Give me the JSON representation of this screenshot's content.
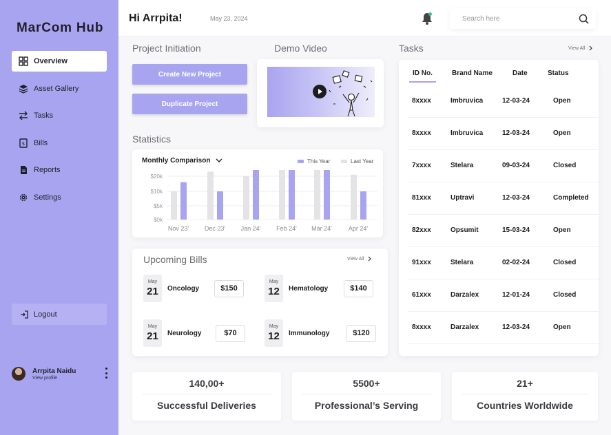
{
  "app": {
    "brand": "MarCom Hub"
  },
  "sidebar": {
    "items": [
      {
        "label": "Overview",
        "icon": "grid-icon",
        "active": true
      },
      {
        "label": "Asset Gallery",
        "icon": "layers-icon"
      },
      {
        "label": "Tasks",
        "icon": "arrows-icon"
      },
      {
        "label": "Bills",
        "icon": "bill-icon"
      },
      {
        "label": "Reports",
        "icon": "report-icon"
      },
      {
        "label": "Settings",
        "icon": "gear-icon"
      }
    ],
    "logout_label": "Logout",
    "profile": {
      "name": "Arrpita Naidu",
      "link": "View profile"
    }
  },
  "header": {
    "greeting": "Hi Arrpita!",
    "date": "May 23, 2024",
    "search_placeholder": "Search here"
  },
  "project": {
    "title": "Project Initiation",
    "create_label": "Create New Project",
    "duplicate_label": "Duplicate Project"
  },
  "video": {
    "title": "Demo Video"
  },
  "statistics": {
    "title": "Statistics",
    "chart_title": "Monthly Comparison",
    "legend_this": "This Year",
    "legend_last": "Last Year"
  },
  "chart_data": {
    "type": "bar",
    "title": "Monthly Comparison",
    "categories": [
      "Nov 23'",
      "Dec 23'",
      "Jan 24'",
      "Feb 24'",
      "Mar 24'",
      "Apr 24'"
    ],
    "series": [
      {
        "name": "Last Year",
        "values": [
          10000,
          23000,
          20000,
          31000,
          25000,
          21000
        ]
      },
      {
        "name": "This Year",
        "values": [
          16000,
          10000,
          26000,
          33000,
          33000,
          10000
        ]
      }
    ],
    "yticks": [
      "$20k",
      "$10k",
      "$5k",
      "$0k"
    ],
    "colors": {
      "this_year": "#a9a4f0",
      "last_year": "#e4e4e7"
    },
    "legend_position": "top-right",
    "grid": true
  },
  "bills": {
    "title": "Upcoming Bills",
    "view_all": "View All",
    "items": [
      {
        "month": "May",
        "day": "21",
        "name": "Oncology",
        "amount": "$150"
      },
      {
        "month": "May",
        "day": "12",
        "name": "Hematology",
        "amount": "$140"
      },
      {
        "month": "May",
        "day": "21",
        "name": "Neurology",
        "amount": "$70"
      },
      {
        "month": "May",
        "day": "12",
        "name": "Immunology",
        "amount": "$120"
      }
    ]
  },
  "tasks": {
    "title": "Tasks",
    "view_all": "View All",
    "columns": [
      "ID No.",
      "Brand Name",
      "Date",
      "Status"
    ],
    "rows": [
      {
        "id": "8xxxx",
        "brand": "Imbruvica",
        "date": "12-03-24",
        "status": "Open"
      },
      {
        "id": "8xxxx",
        "brand": "Imbruvica",
        "date": "12-03-24",
        "status": "Open"
      },
      {
        "id": "7xxxx",
        "brand": "Stelara",
        "date": "09-03-24",
        "status": "Closed"
      },
      {
        "id": "81xxx",
        "brand": "Uptravi",
        "date": "12-03-24",
        "status": "Completed"
      },
      {
        "id": "82xxx",
        "brand": "Opsumit",
        "date": "15-03-24",
        "status": "Open"
      },
      {
        "id": "91xxx",
        "brand": "Stelara",
        "date": "02-02-24",
        "status": "Closed"
      },
      {
        "id": "61xxx",
        "brand": "Darzalex",
        "date": "12-01-24",
        "status": "Closed"
      },
      {
        "id": "8xxxx",
        "brand": "Darzalex",
        "date": "12-03-24",
        "status": "Open"
      }
    ]
  },
  "stats": [
    {
      "value": "140,00+",
      "label": "Successful Deliveries"
    },
    {
      "value": "5500+",
      "label": "Professional’s Serving"
    },
    {
      "value": "21+",
      "label": "Countries Worldwide"
    }
  ],
  "colors": {
    "accent": "#a9a4f0",
    "notification": "#3ec08e"
  }
}
